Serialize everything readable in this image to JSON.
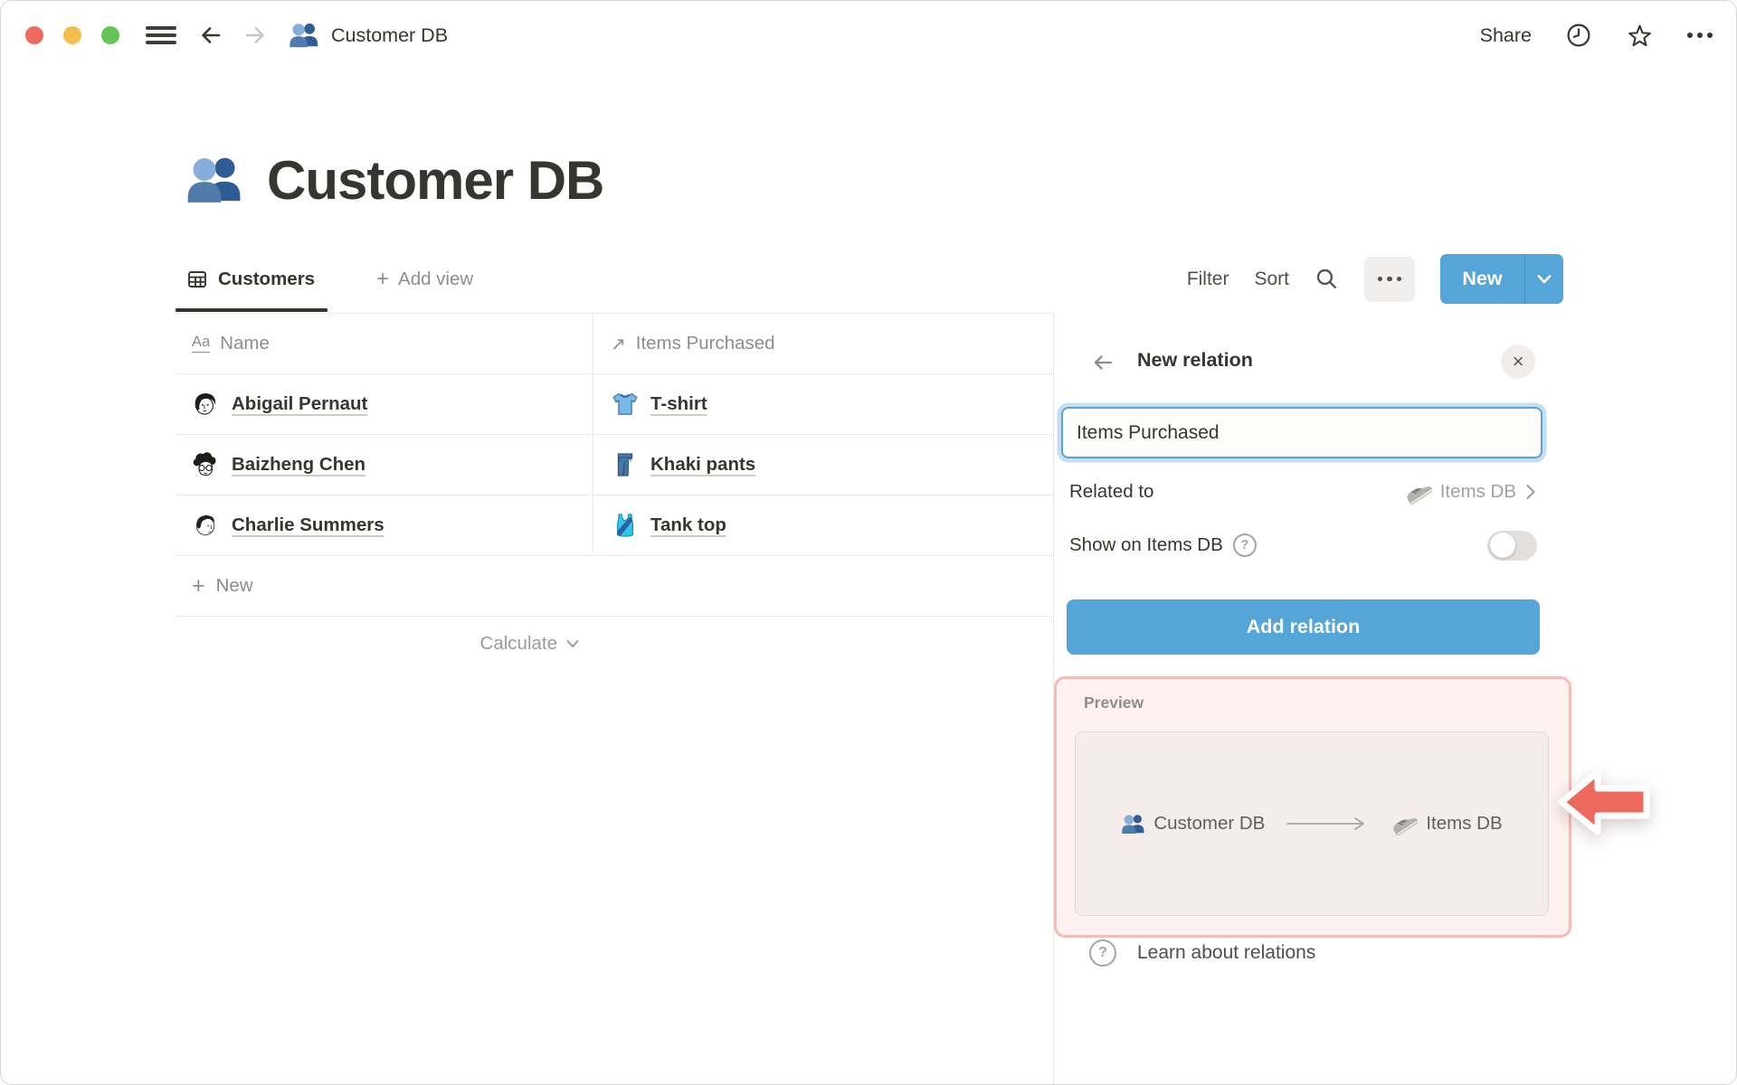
{
  "topbar": {
    "breadcrumb_title": "Customer DB",
    "share": "Share"
  },
  "page": {
    "title": "Customer DB",
    "icon": "busts-in-silhouette"
  },
  "view_bar": {
    "active_tab": "Customers",
    "add_view": "Add view",
    "filter": "Filter",
    "sort": "Sort",
    "new": "New"
  },
  "table": {
    "columns": [
      {
        "label": "Name",
        "type": "title"
      },
      {
        "label": "Items Purchased",
        "type": "relation"
      }
    ],
    "rows": [
      {
        "name": "Abigail Pernaut",
        "item": "T-shirt",
        "item_icon": "t-shirt"
      },
      {
        "name": "Baizheng Chen",
        "item": "Khaki pants",
        "item_icon": "jeans"
      },
      {
        "name": "Charlie Summers",
        "item": "Tank top",
        "item_icon": "tank-top"
      }
    ],
    "new_row": "New",
    "calculate": "Calculate"
  },
  "relation_panel": {
    "title": "New relation",
    "name_value": "Items Purchased",
    "related_to_label": "Related to",
    "related_to_value": "Items DB",
    "related_to_icon": "sneaker",
    "show_on_label": "Show on Items DB",
    "show_on_enabled": false,
    "add_button": "Add relation",
    "preview_label": "Preview",
    "preview_source": "Customer DB",
    "preview_target": "Items DB",
    "learn_link": "Learn about relations"
  },
  "icons": {
    "plus": "+",
    "close": "×",
    "question": "?",
    "title_type": "Aa",
    "relation_arrow": "↗"
  },
  "colors": {
    "accent_blue": "#56a5d8",
    "text_primary": "#37352f",
    "text_secondary": "#8e8d89",
    "divider": "#e9e9e7",
    "highlight_border": "#f6bcb5",
    "highlight_bg": "#fdf2f0",
    "annotation_red": "#ee695d",
    "traffic_red": "#ec6a5e",
    "traffic_yellow": "#f4bf4f",
    "traffic_green": "#62c554"
  }
}
